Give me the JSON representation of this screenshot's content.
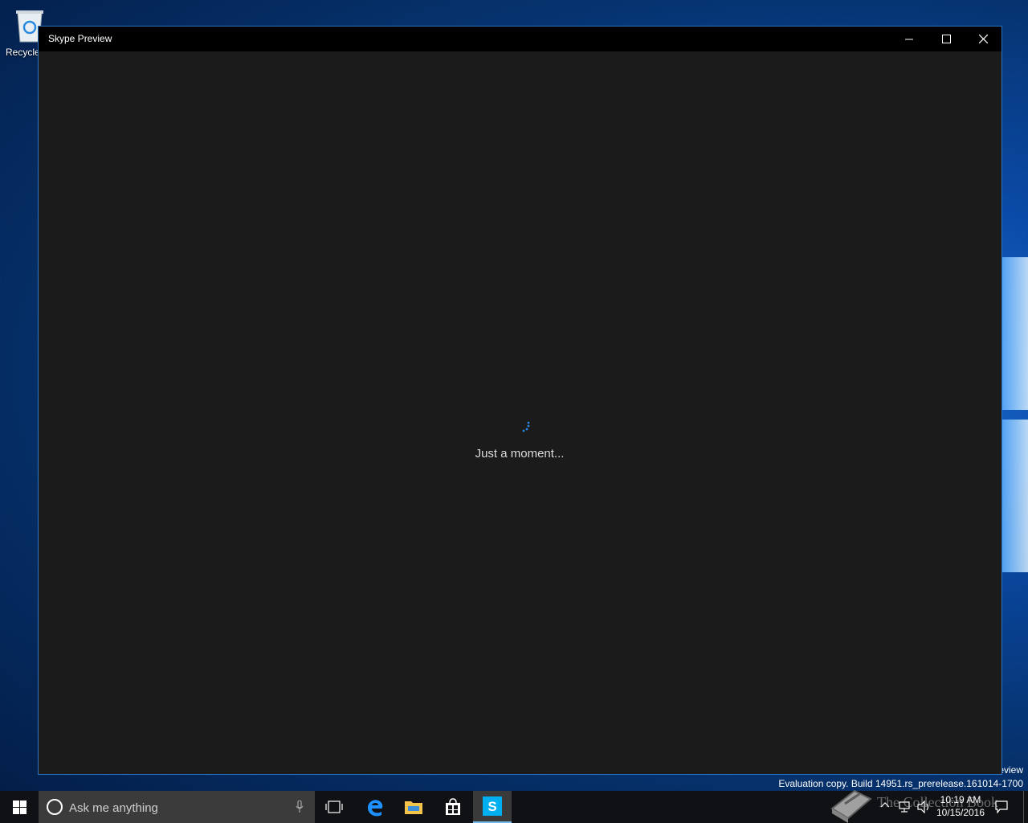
{
  "desktop": {
    "recycle_bin_label": "Recycle",
    "watermark_line1": "eview",
    "watermark_build": "Evaluation copy. Build 14951.rs_prerelease.161014-1700"
  },
  "window": {
    "title": "Skype Preview",
    "loading_text": "Just a moment...",
    "accent_color": "#2b74c4"
  },
  "taskbar": {
    "search_placeholder": "Ask me anything",
    "pinned": [
      "task-view-icon",
      "edge-icon",
      "file-explorer-icon",
      "store-icon",
      "skype-icon"
    ],
    "active_app": "skype-icon",
    "clock_time": "10:19 AM",
    "clock_date": "10/15/2016",
    "watermark_text": "The Collection Book"
  }
}
